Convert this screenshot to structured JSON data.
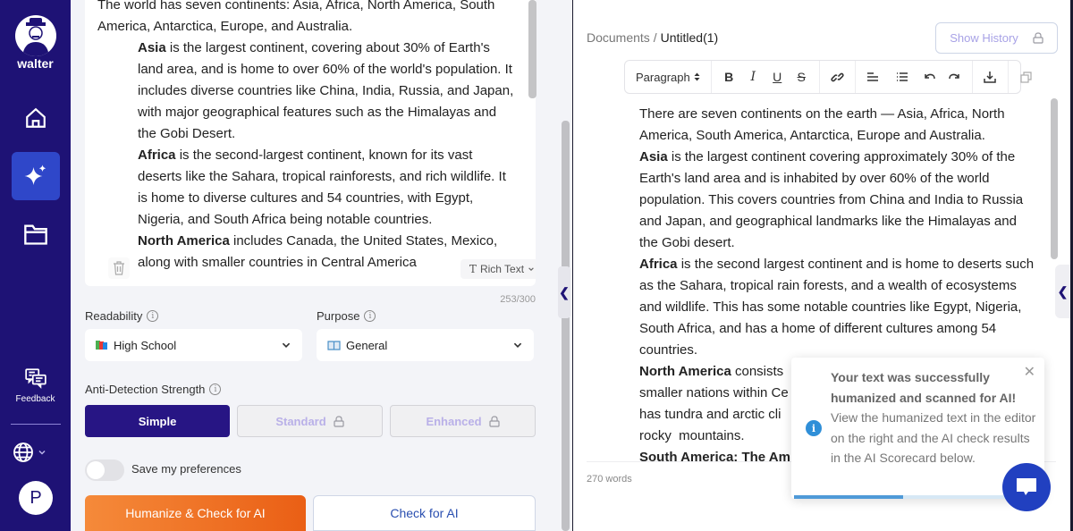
{
  "sidebar": {
    "brand": "walter",
    "items": [
      {
        "name": "home",
        "icon": "home-icon"
      },
      {
        "name": "humanizer",
        "icon": "sparkle-icon",
        "active": true
      },
      {
        "name": "documents",
        "icon": "folder-icon"
      }
    ],
    "feedback_label": "Feedback",
    "language_icon": "globe-icon",
    "avatar_initial": "P"
  },
  "input": {
    "intro": "The world has seven continents: Asia, Africa, North America, South America, Antarctica, Europe, and Australia.",
    "paragraphs": [
      {
        "bold": "Asia",
        "text": " is the largest continent, covering about 30% of Earth's land area, and is home to over 60% of the world's population. It includes diverse countries like China, India, Russia, and Japan, with major geographical features such as the Himalayas and the Gobi Desert."
      },
      {
        "bold": "Africa",
        "text": " is the second-largest continent, known for its vast deserts like the Sahara, tropical rainforests, and rich wildlife. It is home to diverse cultures and 54 countries, with Egypt, Nigeria, and South Africa being notable countries."
      },
      {
        "bold": "North America",
        "text": " includes Canada, the United States, Mexico, along with smaller countries in Central America"
      }
    ],
    "format_label": "Rich Text",
    "char_count": "253/300"
  },
  "settings": {
    "readability_label": "Readability",
    "readability_value": "High School",
    "purpose_label": "Purpose",
    "purpose_value": "General",
    "strength_label": "Anti-Detection Strength",
    "strength_options": [
      {
        "label": "Simple",
        "active": true,
        "locked": false
      },
      {
        "label": "Standard",
        "active": false,
        "locked": true
      },
      {
        "label": "Enhanced",
        "active": false,
        "locked": true
      }
    ],
    "save_prefs_label": "Save my preferences",
    "save_prefs_on": false,
    "humanize_button": "Humanize & Check for AI",
    "check_button": "Check for AI"
  },
  "editor": {
    "breadcrumb_root": "Documents /",
    "breadcrumb_current": "Untitled(1)",
    "history_button": "Show History",
    "toolbar": {
      "paragraph_select": "Paragraph",
      "buttons": [
        "bold",
        "italic",
        "underline",
        "strikethrough",
        "link",
        "align-left",
        "bullet-list",
        "undo",
        "redo",
        "download",
        "copy"
      ]
    },
    "intro": "There are seven continents on the earth  — Asia, Africa, North America, South America, Antarctica, Europe and Australia.",
    "paragraphs": [
      {
        "bold": "Asia",
        "text": " is the largest continent covering approximately 30% of the Earth's land  area and is inhabited by over 60% of the world population. This covers countries from China and India to Russia and Japan, and geographical landmarks  like the Himalayas and the Gobi desert."
      },
      {
        "bold": "Africa",
        "text": " is the second largest continent and is home  to deserts such as the Sahara, tropical rain forests, and a wealth of ecosystems and wildlife. This has some  notable countries like Egypt, Nigeria, South Africa, and has a home of different cultures among 54 countries."
      },
      {
        "bold": "North America",
        "text": " consists of ... smaller nations within Ce... has tundra and arctic cli... rocky  mountains."
      },
      {
        "bold": "South America: The Am",
        "text": ""
      }
    ],
    "word_count": "270 words"
  },
  "toast": {
    "title": "Your text was successfully humanized and scanned for AI!",
    "message": "View the humanized text in the editor on the right and the AI check results in the AI Scorecard below.",
    "progress": 0.45
  },
  "colors": {
    "sidebar_bg": "#1e1275",
    "active_nav": "#2f47c9",
    "primary": "#271584",
    "cta_orange": "#ea5f15",
    "link_blue": "#2a4fb0",
    "info_blue": "#2f8fd8"
  }
}
